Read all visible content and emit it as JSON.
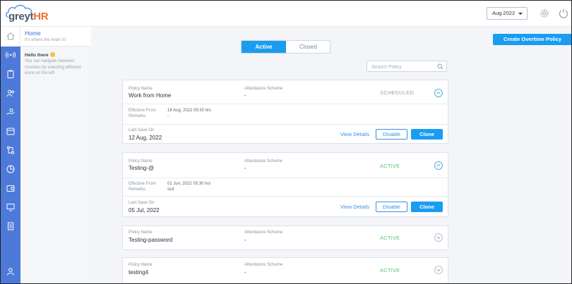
{
  "header": {
    "logo_text": "greytHR",
    "month_select": "Aug 2022"
  },
  "module_panel": {
    "home_title": "Home",
    "home_subtitle": "It's where the heart is!",
    "hello_title": "Hello there",
    "hello_body": "You can navigate between modules by selecting different icons on the left"
  },
  "toolbar": {
    "create_button": "Create Overtime Policy",
    "tabs": [
      "Active",
      "Closed"
    ],
    "search_placeholder": "Search Policy"
  },
  "labels": {
    "policy_name": "Policy Name",
    "attendance_scheme": "Attendance Scheme",
    "effective_from": "Effective From",
    "remarks": "Remarks",
    "last_save_on": "Last Save On",
    "view_details": "View Details",
    "disable": "Disable",
    "clone": "Clone"
  },
  "policies": [
    {
      "name": "Work from Home",
      "attendance_scheme": "-",
      "status": "SCHEDULED",
      "effective_from": "16 Aug, 2022 05:30 hrs",
      "remarks": "-",
      "last_save_on": "12 Aug, 2022"
    },
    {
      "name": "Testing-@",
      "attendance_scheme": "-",
      "status": "ACTIVE",
      "effective_from": "01 Jun, 2022 05:30 hrs",
      "remarks": "scd",
      "last_save_on": "05 Jul, 2022"
    },
    {
      "name": "Testing-password",
      "attendance_scheme": "-",
      "status": "ACTIVE"
    },
    {
      "name": "testing4",
      "attendance_scheme": "-",
      "status": "ACTIVE"
    }
  ],
  "colors": {
    "primary": "#1a9df0",
    "rail": "#4d7ad9",
    "active_status": "#5cc374",
    "scheduled_status": "#9aa5b1",
    "logo_accent": "#e8742f"
  }
}
